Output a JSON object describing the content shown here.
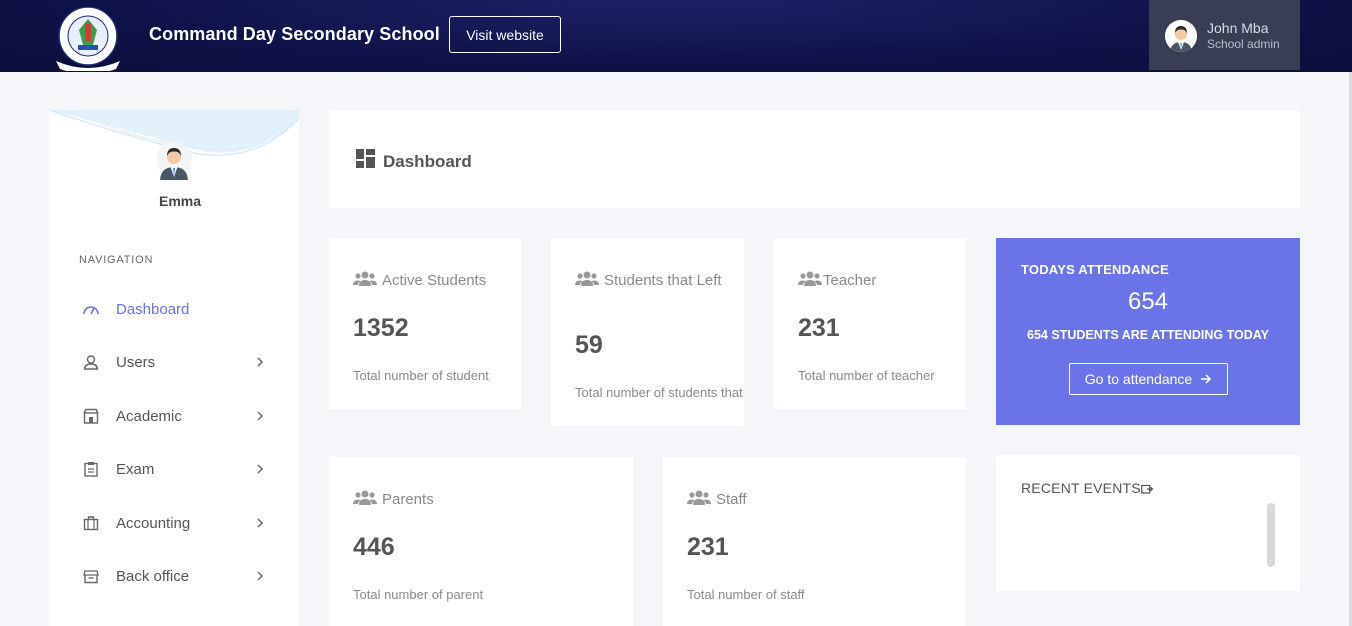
{
  "header": {
    "school_name": "Command Day Secondary School",
    "visit_label": "Visit website",
    "user_name": "John Mba",
    "user_role": "School admin",
    "logo_text": "COMMAND DAY SECONDARY SCHOOL"
  },
  "sidebar": {
    "profile_name": "Emma",
    "nav_title": "NAVIGATION",
    "items": [
      {
        "label": "Dashboard",
        "icon": "speedometer-icon",
        "active": true
      },
      {
        "label": "Users",
        "icon": "user-icon"
      },
      {
        "label": "Academic",
        "icon": "building-icon"
      },
      {
        "label": "Exam",
        "icon": "clipboard-icon"
      },
      {
        "label": "Accounting",
        "icon": "briefcase-icon"
      },
      {
        "label": "Back office",
        "icon": "inbox-icon"
      }
    ]
  },
  "main": {
    "page_title": "Dashboard",
    "stats": [
      {
        "label": "Active Students",
        "value": "1352",
        "desc": "Total number of student"
      },
      {
        "label": "Students that Left",
        "value": "59",
        "desc": "Total number of students that left"
      },
      {
        "label": "Teacher",
        "value": "231",
        "desc": "Total number of teacher"
      },
      {
        "label": "Parents",
        "value": "446",
        "desc": "Total number of parent"
      },
      {
        "label": "Staff",
        "value": "231",
        "desc": "Total number of staff"
      }
    ],
    "attendance": {
      "title": "TODAYS ATTENDANCE",
      "count": "654",
      "desc": "654 STUDENTS ARE ATTENDING TODAY",
      "button_label": "Go to attendance"
    },
    "events": {
      "title": "RECENT EVENTS"
    }
  },
  "colors": {
    "header_bg": "#0f1248",
    "accent": "#6b73e8",
    "active_nav": "#6a72e8"
  }
}
